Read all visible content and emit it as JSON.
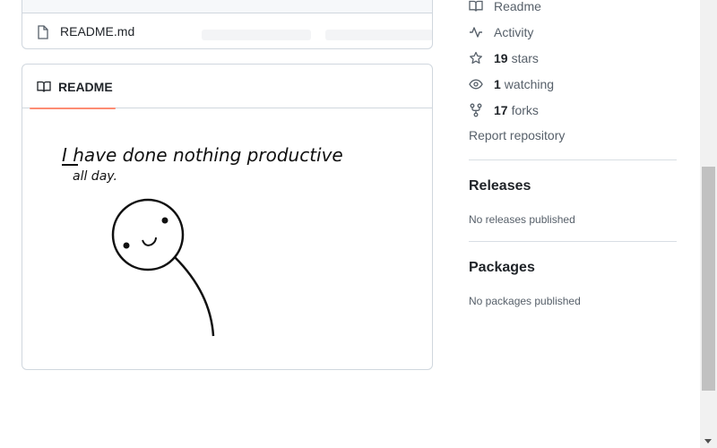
{
  "file_list": {
    "row": {
      "name": "README.md"
    }
  },
  "readme": {
    "tab_label": "README",
    "image_text": {
      "line1": "I have done nothing productive",
      "line2": "all day."
    }
  },
  "sidebar": {
    "readme_link": "Readme",
    "activity_link": "Activity",
    "stars": {
      "count": "19",
      "label": "stars"
    },
    "watching": {
      "count": "1",
      "label": "watching"
    },
    "forks": {
      "count": "17",
      "label": "forks"
    },
    "report": "Report repository",
    "releases": {
      "title": "Releases",
      "note": "No releases published"
    },
    "packages": {
      "title": "Packages",
      "note": "No packages published"
    }
  },
  "colors": {
    "tab_underline": "#fd8c73",
    "border": "#d0d7de",
    "muted_text": "#57606a"
  }
}
